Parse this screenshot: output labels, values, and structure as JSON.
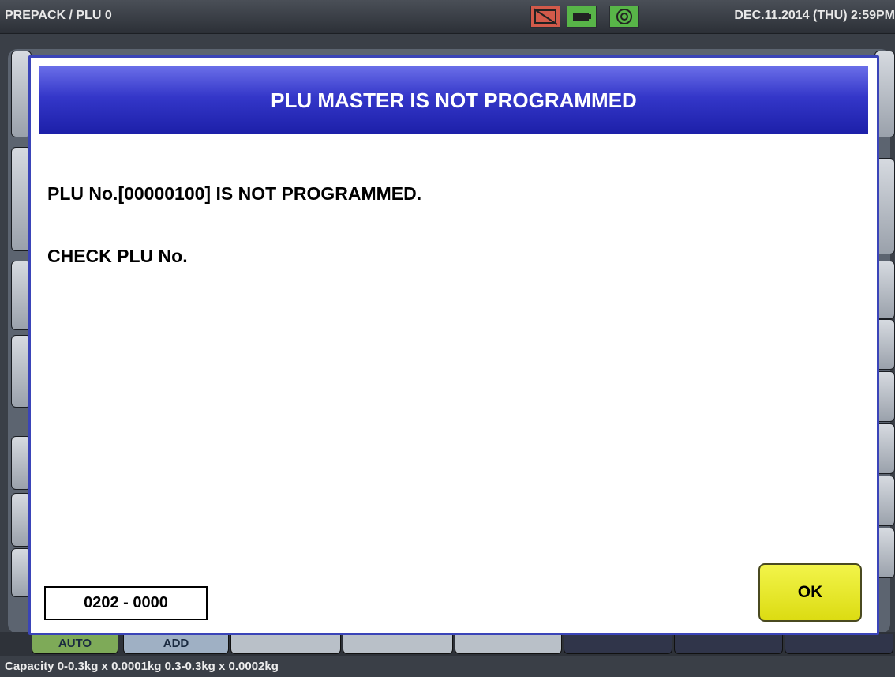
{
  "status_bar": {
    "title": "PREPACK / PLU 0",
    "datetime": "DEC.11.2014 (THU)  2:59PM",
    "icons": [
      "printer-status-icon",
      "battery-icon",
      "network-icon"
    ],
    "icon_colors": {
      "printer": "#d25a4a",
      "battery": "#58b548",
      "network": "#58b548"
    }
  },
  "dialog": {
    "title": "PLU MASTER IS NOT PROGRAMMED",
    "message_line1": "PLU No.[00000100] IS NOT PROGRAMMED.",
    "message_line2": "CHECK PLU No.",
    "error_code": "0202 - 0000",
    "ok_label": "OK",
    "header_color": "#3437c9",
    "ok_color": "#eeee30"
  },
  "soft_keys": {
    "auto_label": "AUTO",
    "add_label": "ADD"
  },
  "footer": {
    "capacity": "Capacity 0-0.3kg x 0.0001kg  0.3-0.3kg x 0.0002kg"
  }
}
